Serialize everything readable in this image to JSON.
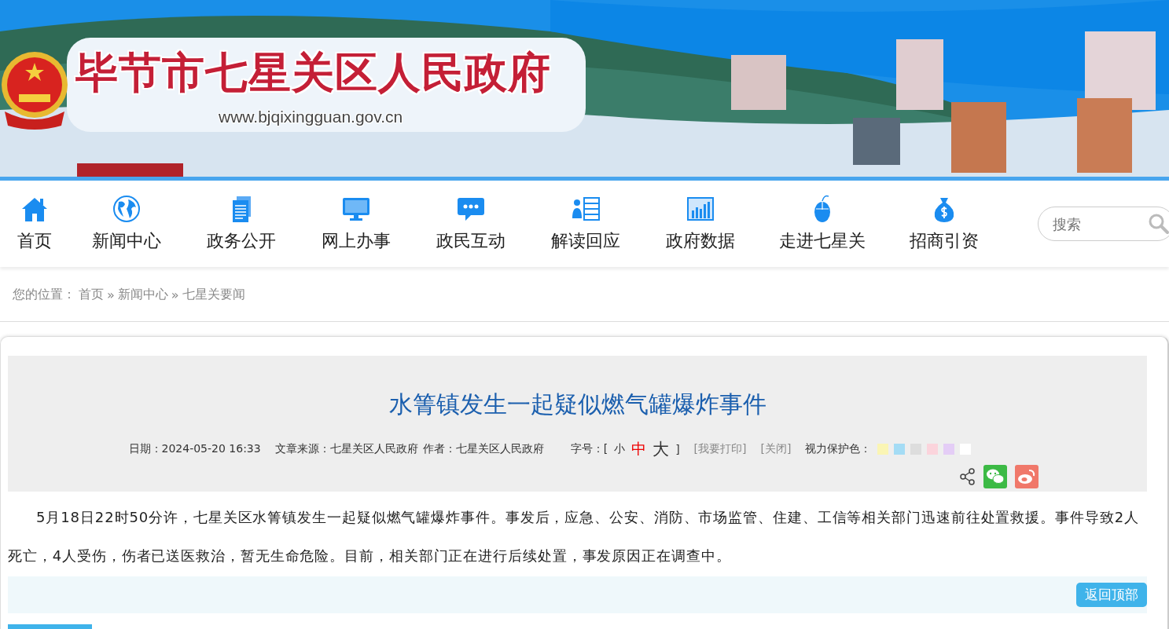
{
  "header": {
    "site_title": "毕节市七星关区人民政府",
    "site_url": "www.bjqixingguan.gov.cn"
  },
  "nav": {
    "items": [
      {
        "label": "首页"
      },
      {
        "label": "新闻中心"
      },
      {
        "label": "政务公开"
      },
      {
        "label": "网上办事"
      },
      {
        "label": "政民互动"
      },
      {
        "label": "解读回应"
      },
      {
        "label": "政府数据"
      },
      {
        "label": "走进七星关"
      },
      {
        "label": "招商引资"
      }
    ],
    "search": {
      "placeholder": "搜索"
    }
  },
  "breadcrumb": {
    "label": "您的位置：",
    "items": [
      "首页",
      "新闻中心",
      "七星关要闻"
    ],
    "separator": "»"
  },
  "article": {
    "title": "水箐镇发生一起疑似燃气罐爆炸事件",
    "meta": {
      "date": "日期：2024-05-20 16:33",
      "source": "文章来源：七星关区人民政府",
      "author": "作者：七星关区人民政府",
      "font_size_label": "字号：[",
      "font_size_close": "]",
      "font_sizes": [
        {
          "label": "小",
          "selected": false
        },
        {
          "label": "中",
          "selected": true
        },
        {
          "label": "大",
          "selected": false
        }
      ],
      "print": "[我要打印]",
      "close": "[关闭]",
      "eye_care_label": "视力保护色：",
      "eye_care_colors": [
        {
          "color": "#faf5b4"
        },
        {
          "color": "#a4dcf5"
        },
        {
          "color": "#dddddd"
        },
        {
          "color": "#fbd4dc"
        },
        {
          "color": "#e4cdf6"
        },
        {
          "color": "#ffffff"
        }
      ]
    },
    "share": [
      {
        "kind": "share"
      },
      {
        "kind": "wechat"
      },
      {
        "kind": "weibo"
      }
    ],
    "body": "5月18日22时50分许，七星关区水箐镇发生一起疑似燃气罐爆炸事件。事发后，应急、公安、消防、市场监管、住建、工信等相关部门迅速前往处置救援。事件导致2人死亡，4人受伤，伤者已送医救治，暂无生命危险。目前，相关部门正在进行后续处置，事发原因正在调查中。",
    "back_to_top": "返回顶部"
  }
}
